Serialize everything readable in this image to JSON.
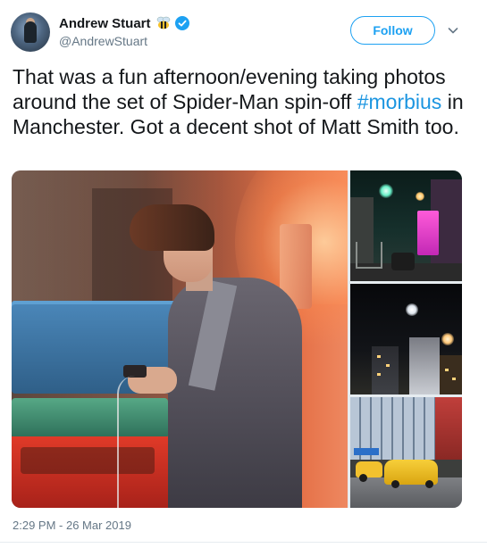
{
  "author": {
    "display_name": "Andrew Stuart",
    "handle": "@AndrewStuart",
    "badge_icons": [
      "bee-icon",
      "verified-badge-icon"
    ],
    "verified_color": "#1da1f2"
  },
  "actions": {
    "follow_label": "Follow",
    "menu_icon": "chevron-down-icon"
  },
  "tweet": {
    "text_before": "That was a fun afternoon/evening taking photos around the set of Spider-Man spin-off ",
    "hashtag": "#morbius",
    "text_after": " in Manchester. Got a decent shot of Matt Smith too.",
    "hashtag_color": "#1b95e0"
  },
  "media": {
    "photo_count": 4
  },
  "meta": {
    "timestamp": "2:29 PM - 26 Mar 2019"
  },
  "colors": {
    "accent": "#1da1f2",
    "text_primary": "#14171a",
    "text_secondary": "#657786"
  }
}
